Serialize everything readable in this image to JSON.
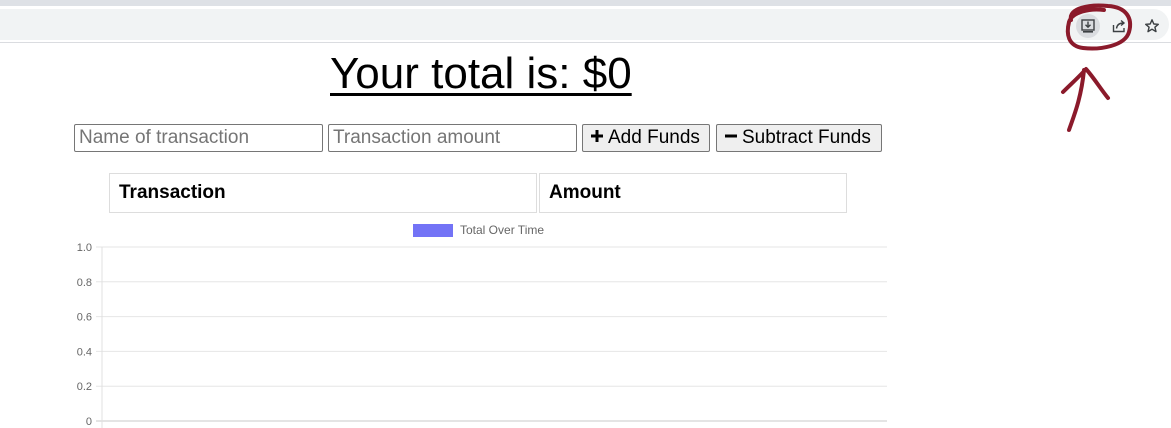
{
  "browser": {
    "toolbar_icons": [
      "install-app-icon",
      "share-icon",
      "star-icon"
    ],
    "annotation_color": "#8b1a2b"
  },
  "page": {
    "total_text": "Your total is: $0",
    "name_placeholder": "Name of transaction",
    "amount_placeholder": "Transaction amount",
    "add_button": "Add Funds",
    "subtract_button": "Subtract Funds",
    "table_headers": [
      "Transaction",
      "Amount"
    ]
  },
  "chart_data": {
    "type": "line",
    "legend": "Total Over Time",
    "legend_color": "#6b6bf5",
    "yticks": [
      "1.0",
      "0.8",
      "0.6",
      "0.4",
      "0.2",
      "0"
    ],
    "ylim": [
      0,
      1
    ],
    "x": [],
    "values": [],
    "grid": true,
    "legend_position": "top-center"
  }
}
